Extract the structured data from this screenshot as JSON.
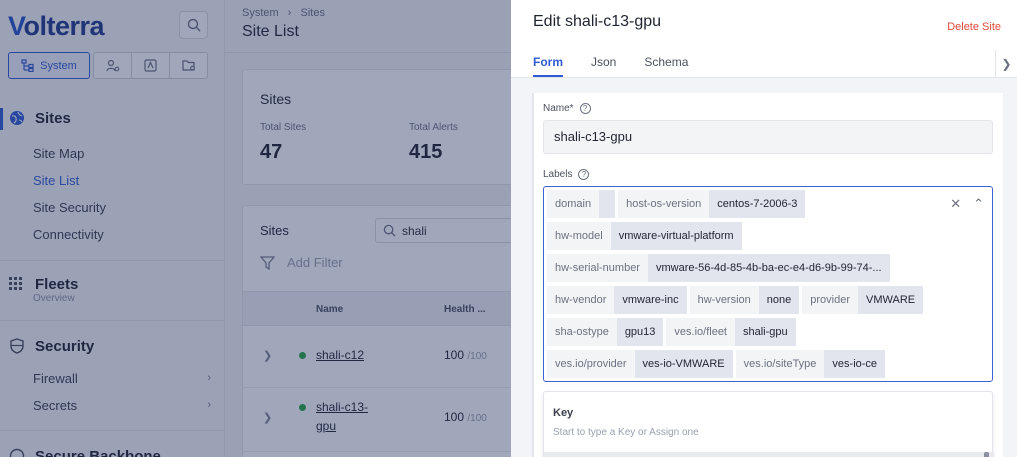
{
  "app": {
    "logo": "olterra",
    "logo_mark": "V"
  },
  "workspace_tabs": {
    "active_label": "System"
  },
  "sidebar": {
    "sites": {
      "title": "Sites",
      "items": [
        "Site Map",
        "Site List",
        "Site Security",
        "Connectivity"
      ],
      "active": "Site List"
    },
    "fleets": {
      "title": "Fleets",
      "subtitle": "Overview"
    },
    "security": {
      "title": "Security",
      "items": [
        "Firewall",
        "Secrets"
      ]
    },
    "backbone": {
      "title": "Secure Backbone"
    }
  },
  "page": {
    "breadcrumb": [
      "System",
      "Sites"
    ],
    "title": "Site List",
    "summary": {
      "title": "Sites",
      "total_sites_label": "Total Sites",
      "total_sites": "47",
      "total_alerts_label": "Total Alerts",
      "total_alerts": "415"
    },
    "table": {
      "title": "Sites",
      "search_value": "shali",
      "filter_label": "Add Filter",
      "columns": [
        "Name",
        "Health ..."
      ],
      "rows": [
        {
          "name": "shali-c12",
          "health": "100",
          "health_max": "/100"
        },
        {
          "name": "shali-c13-gpu",
          "name_line1": "shali-c13-",
          "name_line2": "gpu",
          "health": "100",
          "health_max": "/100"
        }
      ]
    }
  },
  "panel": {
    "title": "Edit shali-c13-gpu",
    "delete_label": "Delete Site",
    "tabs": [
      "Form",
      "Json",
      "Schema"
    ],
    "active_tab": "Form",
    "name_label": "Name*",
    "name_value": "shali-c13-gpu",
    "labels_label": "Labels",
    "labels": [
      {
        "key": "domain",
        "value": ""
      },
      {
        "key": "host-os-version",
        "value": "centos-7-2006-3"
      },
      {
        "key": "hw-model",
        "value": "vmware-virtual-platform"
      },
      {
        "key": "hw-serial-number",
        "value": "vmware-56-4d-85-4b-ba-ec-e4-d6-9b-99-74-..."
      },
      {
        "key": "hw-vendor",
        "value": "vmware-inc"
      },
      {
        "key": "hw-version",
        "value": "none"
      },
      {
        "key": "provider",
        "value": "VMWARE"
      },
      {
        "key": "sha-ostype",
        "value": "gpu13"
      },
      {
        "key": "ves.io/fleet",
        "value": "shali-gpu"
      },
      {
        "key": "ves.io/provider",
        "value": "ves-io-VMWARE"
      },
      {
        "key": "ves.io/siteType",
        "value": "ves-io-ce"
      }
    ],
    "key_box": {
      "title": "Key",
      "hint": "Start to type a Key or Assign one"
    }
  },
  "colors": {
    "accent": "#2f5bd3",
    "danger": "#e0493b",
    "overlay": "#1f2d5a",
    "healthy": "#27a844"
  }
}
